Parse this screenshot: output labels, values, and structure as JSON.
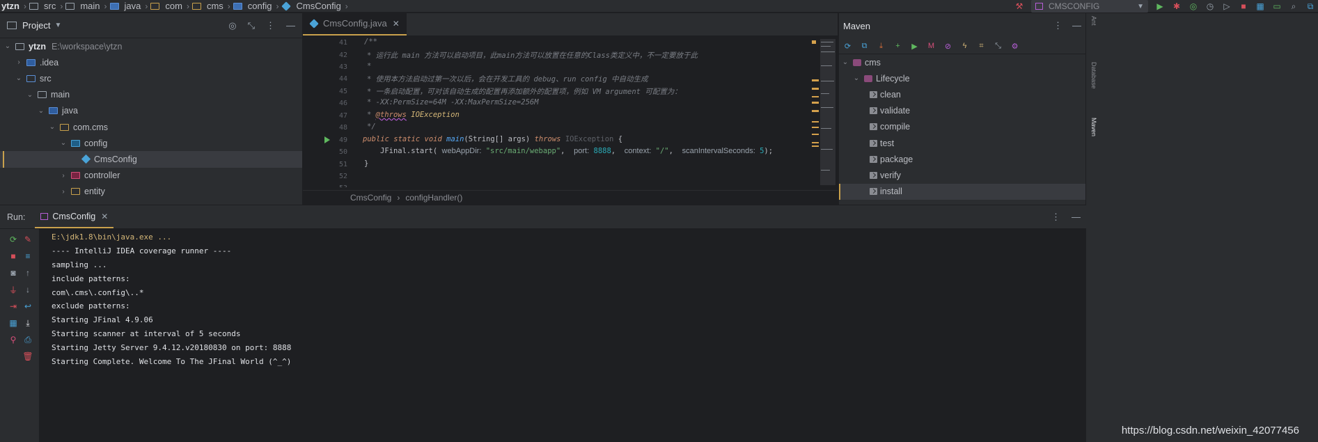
{
  "breadcrumb": [
    "ytzn",
    "src",
    "main",
    "java",
    "com",
    "cms",
    "config",
    "CmsConfig"
  ],
  "run_config": {
    "name": "CMSCONFIG"
  },
  "project_panel": {
    "title": "Project",
    "tree": [
      {
        "label": "ytzn",
        "path": "E:\\workspace\\ytzn",
        "arrow": "⌄",
        "icon": "folder"
      },
      {
        "label": ".idea",
        "arrow": "›",
        "icon": "folder-blue"
      },
      {
        "label": "src",
        "arrow": "⌄",
        "icon": "folder-src"
      },
      {
        "label": "main",
        "arrow": "⌄",
        "icon": "folder"
      },
      {
        "label": "java",
        "arrow": "⌄",
        "icon": "folder-blue"
      },
      {
        "label": "com.cms",
        "arrow": "⌄",
        "icon": "package"
      },
      {
        "label": "config",
        "arrow": "⌄",
        "icon": "package-config"
      },
      {
        "label": "CmsConfig",
        "arrow": "",
        "icon": "class"
      },
      {
        "label": "controller",
        "arrow": "›",
        "icon": "package-controller"
      },
      {
        "label": "entity",
        "arrow": "›",
        "icon": "package"
      }
    ]
  },
  "editor": {
    "tab_label": "CmsConfig.java",
    "line_numbers": [
      "41",
      "42",
      "43",
      "44",
      "45",
      "46",
      "47",
      "48",
      "49",
      "50",
      "51",
      "52",
      "53"
    ],
    "code": {
      "l41": "/**",
      "l42": "* 运行此 main 方法可以启动项目，此main方法可以放置在任意的Class类定义中，不一定要放于此",
      "l43": "*",
      "l44": "* 使用本方法启动过第一次以后，会在开发工具的 debug、run config 中自动生成",
      "l45": "* 一条启动配置，可对该自动生成的配置再添加额外的配置项，例如 VM argument 可配置为：",
      "l46": "* -XX:PermSize=64M -XX:MaxPermSize=256M",
      "l47a": "* ",
      "l47b": "@throws",
      "l47c": " IOException",
      "l48": "*/",
      "l49_kw": "public static void",
      "l49_fn": "main",
      "l49_sig": "(String[] args) ",
      "l49_throws": "throws",
      "l49_exc": " IOException",
      "l49_end": " {",
      "l50_call": "JFinal.start(",
      "l50_h1": "webAppDir:",
      "l50_s1": "\"src/main/webapp\"",
      "l50_h2": "port:",
      "l50_n1": "8888",
      "l50_h3": "context:",
      "l50_s2": "\"/\"",
      "l50_h4": "scanIntervalSeconds:",
      "l50_n2": "5",
      "l50_end": ");",
      "l51": "}"
    },
    "crumb_class": "CmsConfig",
    "crumb_method": "configHandler()"
  },
  "maven": {
    "title": "Maven",
    "tree": [
      {
        "label": "cms",
        "arrow": "⌄",
        "level": 0
      },
      {
        "label": "Lifecycle",
        "arrow": "⌄",
        "level": 1
      },
      {
        "label": "clean",
        "level": 2
      },
      {
        "label": "validate",
        "level": 2
      },
      {
        "label": "compile",
        "level": 2
      },
      {
        "label": "test",
        "level": 2
      },
      {
        "label": "package",
        "level": 2
      },
      {
        "label": "verify",
        "level": 2
      },
      {
        "label": "install",
        "level": 2
      }
    ]
  },
  "right_strip": [
    "Ant",
    "Database",
    "Maven"
  ],
  "run_panel": {
    "label": "Run:",
    "tab_label": "CmsConfig",
    "console": [
      "E:\\jdk1.8\\bin\\java.exe ...",
      "---- IntelliJ IDEA coverage runner ----",
      "sampling ...",
      "include patterns:",
      "com\\.cms\\.config\\..*",
      "exclude patterns:",
      "Starting JFinal 4.9.06",
      "Starting scanner at interval of 5 seconds",
      "Starting Jetty Server 9.4.12.v20180830 on port: 8888",
      "Starting Complete. Welcome To The JFinal World (^_^)"
    ]
  },
  "watermark": "https://blog.csdn.net/weixin_42077456",
  "colors": {
    "accent": "#c9a14c",
    "background": "#1e1f22",
    "panel": "#2b2d30",
    "keyword": "#cf8e6d",
    "string": "#6aab73",
    "number": "#2aacb8",
    "comment": "#7a7e85"
  }
}
